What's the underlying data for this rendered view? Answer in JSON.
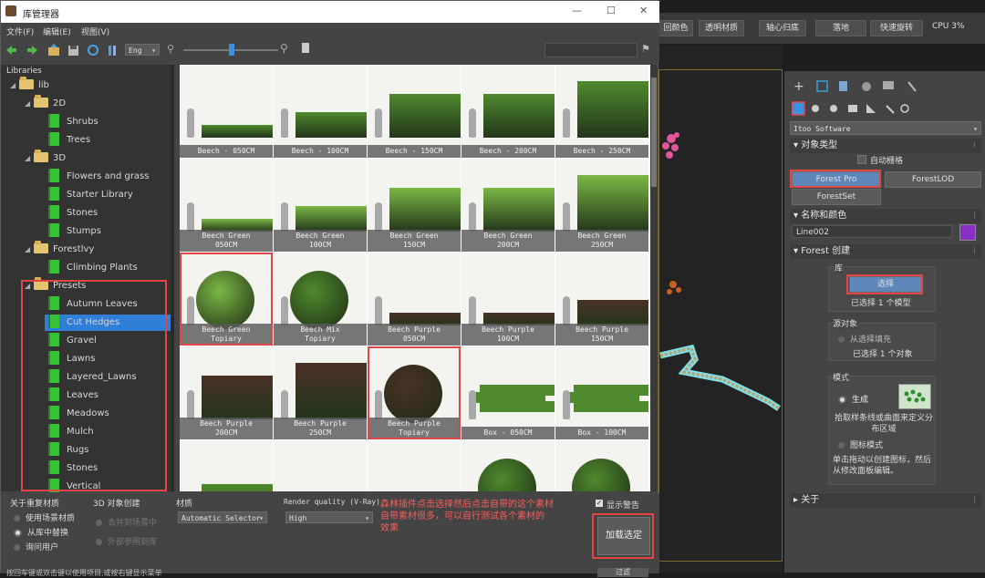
{
  "max_toolbar": {
    "buttons": [
      "回颜色",
      "透明材质",
      "轴心归底",
      "落地",
      "快速旋转"
    ],
    "cpu_label": "CPU 3%"
  },
  "window": {
    "title": "库管理器",
    "controls": {
      "minimize": "—",
      "maximize": "☐",
      "close": "✕"
    },
    "menu": [
      "文件(F)",
      "编辑(E)",
      "视图(V)"
    ],
    "lang_select": "Eng"
  },
  "tree": {
    "header": "Libraries",
    "items": [
      {
        "label": "lib",
        "type": "folder",
        "level": 0
      },
      {
        "label": "2D",
        "type": "folder",
        "level": 1
      },
      {
        "label": "Shrubs",
        "type": "book",
        "level": 2
      },
      {
        "label": "Trees",
        "type": "book",
        "level": 2
      },
      {
        "label": "3D",
        "type": "folder",
        "level": 1
      },
      {
        "label": "Flowers and grass",
        "type": "book",
        "level": 2
      },
      {
        "label": "Starter Library",
        "type": "book",
        "level": 2
      },
      {
        "label": "Stones",
        "type": "book",
        "level": 2
      },
      {
        "label": "Stumps",
        "type": "book",
        "level": 2
      },
      {
        "label": "Forestlvy",
        "type": "folder",
        "level": 1
      },
      {
        "label": "Climbing Plants",
        "type": "book",
        "level": 2
      },
      {
        "label": "Presets",
        "type": "folder",
        "level": 1
      },
      {
        "label": "Autumn Leaves",
        "type": "book",
        "level": 2
      },
      {
        "label": "Cut Hedges",
        "type": "book",
        "level": 2,
        "selected": true
      },
      {
        "label": "Gravel",
        "type": "book",
        "level": 2
      },
      {
        "label": "Lawns",
        "type": "book",
        "level": 2
      },
      {
        "label": "Layered_Lawns",
        "type": "book",
        "level": 2
      },
      {
        "label": "Leaves",
        "type": "book",
        "level": 2
      },
      {
        "label": "Meadows",
        "type": "book",
        "level": 2
      },
      {
        "label": "Mulch",
        "type": "book",
        "level": 2
      },
      {
        "label": "Rugs",
        "type": "book",
        "level": 2
      },
      {
        "label": "Stones",
        "type": "book",
        "level": 2
      },
      {
        "label": "Vertical",
        "type": "book",
        "level": 2
      }
    ]
  },
  "grid": {
    "items": [
      {
        "label": "Beech - 050CM",
        "color": "green",
        "shape": "hedge-low"
      },
      {
        "label": "Beech - 100CM",
        "color": "green",
        "shape": "hedge-mid"
      },
      {
        "label": "Beech - 150CM",
        "color": "green",
        "shape": "hedge-tall"
      },
      {
        "label": "Beech - 200CM",
        "color": "green",
        "shape": "hedge-tall"
      },
      {
        "label": "Beech - 250CM",
        "color": "green",
        "shape": "hedge-tallest"
      },
      {
        "label": "Beech Green\n050CM",
        "color": "lightgreen",
        "shape": "hedge-low"
      },
      {
        "label": "Beech Green\n100CM",
        "color": "lightgreen",
        "shape": "hedge-mid"
      },
      {
        "label": "Beech Green\n150CM",
        "color": "lightgreen",
        "shape": "hedge-tall"
      },
      {
        "label": "Beech Green\n200CM",
        "color": "lightgreen",
        "shape": "hedge-tall"
      },
      {
        "label": "Beech Green\n250CM",
        "color": "lightgreen",
        "shape": "hedge-tallest"
      },
      {
        "label": "Beech Green\nTopiary",
        "color": "lightgreen",
        "shape": "topiary",
        "highlighted": true
      },
      {
        "label": "Beech Mix\nTopiary",
        "color": "green",
        "shape": "topiary"
      },
      {
        "label": "Beech Purple\n050CM",
        "color": "purple",
        "shape": "hedge-low"
      },
      {
        "label": "Beech Purple\n100CM",
        "color": "purple",
        "shape": "hedge-low"
      },
      {
        "label": "Beech Purple\n150CM",
        "color": "purple",
        "shape": "hedge-mid"
      },
      {
        "label": "Beech Purple\n200CM",
        "color": "purple",
        "shape": "hedge-tall"
      },
      {
        "label": "Beech Purple\n250CM",
        "color": "purple",
        "shape": "hedge-tallest"
      },
      {
        "label": "Beech Purple\nTopiary",
        "color": "purple",
        "shape": "topiary",
        "highlighted": true
      },
      {
        "label": "Box - 050CM",
        "color": "green",
        "shape": "maze"
      },
      {
        "label": "Box - 100CM",
        "color": "green",
        "shape": "maze"
      },
      {
        "label": "",
        "color": "green",
        "shape": "hedge-tall"
      },
      {
        "label": "",
        "color": "green",
        "shape": "hedge-mid"
      },
      {
        "label": "",
        "color": "green",
        "shape": "hedge-mid"
      },
      {
        "label": "",
        "color": "green",
        "shape": "topiary"
      },
      {
        "label": "",
        "color": "green",
        "shape": "topiary"
      }
    ]
  },
  "bottom": {
    "duplicate_materials": {
      "title": "关于重复材质",
      "options": [
        {
          "label": "使用场景材质",
          "selected": false
        },
        {
          "label": "从库中替换",
          "selected": true
        },
        {
          "label": "询问用户",
          "selected": false
        }
      ]
    },
    "object_create": {
      "title": "3D 对象创建",
      "options": [
        {
          "label": "合并到场景中",
          "selected": true
        },
        {
          "label": "外部参照到库",
          "selected": false
        }
      ]
    },
    "material": {
      "title": "材质",
      "value": "Automatic Selector"
    },
    "render_quality": {
      "title": "Render quality (V-Ray)",
      "value": "High"
    },
    "show_warning": {
      "label": "显示警告",
      "checked": true
    },
    "load_button": "加载选定",
    "annotation": "森林插件点击选择然后点击自带的这个素材\n自带素材很多，可以自行测试各个素材的\n效果",
    "status": "按回车键或双击键以使用项目,或按右键显示菜单",
    "status_button": "过滤"
  },
  "command_panel": {
    "category_dropdown": "Itoo Software",
    "object_type": {
      "title": "对象类型",
      "autogrid": "自动栅格",
      "buttons": [
        "Forest Pro",
        "ForestLOD",
        "ForestSet"
      ]
    },
    "name_color": {
      "title": "名称和颜色",
      "name": "Line002",
      "color": "#8a2ec8"
    },
    "forest_create": {
      "title": "Forest 创建",
      "library": {
        "title": "库",
        "button": "选择",
        "status": "已选择 1 个模型"
      },
      "source": {
        "title": "源对象",
        "option": "从选择填充",
        "status": "已选择 1 个对象"
      },
      "mode": {
        "title": "模式",
        "generate": "生成",
        "generate_desc": "拾取样条线或曲面来定义分布区域",
        "icon_mode": "图标模式",
        "icon_desc": "单击拖动以创建图标，然后从修改面板编辑。"
      }
    },
    "about": "关于"
  },
  "colors": {
    "green": "#4f8a2e",
    "lightgreen": "#7bb845",
    "purple": "#4a3226",
    "highlight": "#e24545",
    "selected": "#2f7ed8"
  }
}
